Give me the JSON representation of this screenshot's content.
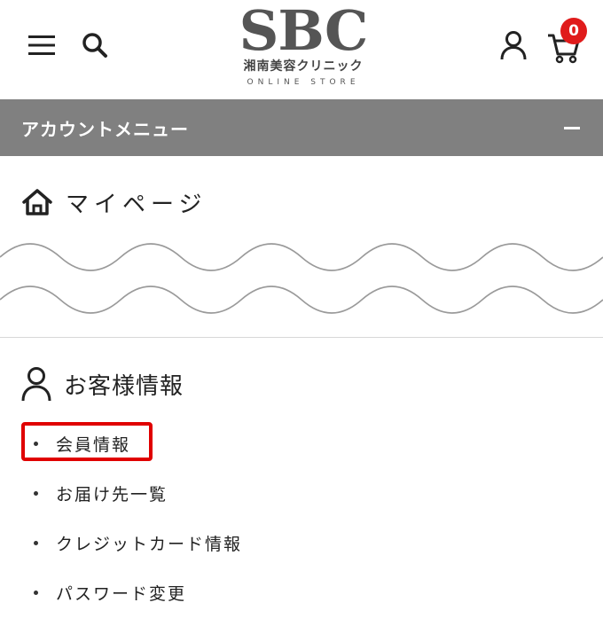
{
  "header": {
    "logo": {
      "main": "SBC",
      "sub": "湘南美容クリニック",
      "store": "ONLINE STORE"
    },
    "icons": {
      "menu": "hamburger-menu-icon",
      "search": "search-icon",
      "account": "user-icon",
      "cart": "cart-icon"
    },
    "cart_count": "0"
  },
  "account_menu": {
    "title": "アカウントメニュー",
    "toggle_icon": "minus-icon"
  },
  "mypage": {
    "label": "マイページ",
    "icon": "home-icon"
  },
  "customer_info": {
    "title": "お客様情報",
    "icon": "user-icon",
    "items": [
      {
        "label": "会員情報",
        "highlighted": true
      },
      {
        "label": "お届け先一覧",
        "highlighted": false
      },
      {
        "label": "クレジットカード情報",
        "highlighted": false
      },
      {
        "label": "パスワード変更",
        "highlighted": false
      }
    ]
  },
  "colors": {
    "menu_bar": "#808080",
    "badge": "#e01b1b",
    "highlight": "#e00000"
  }
}
